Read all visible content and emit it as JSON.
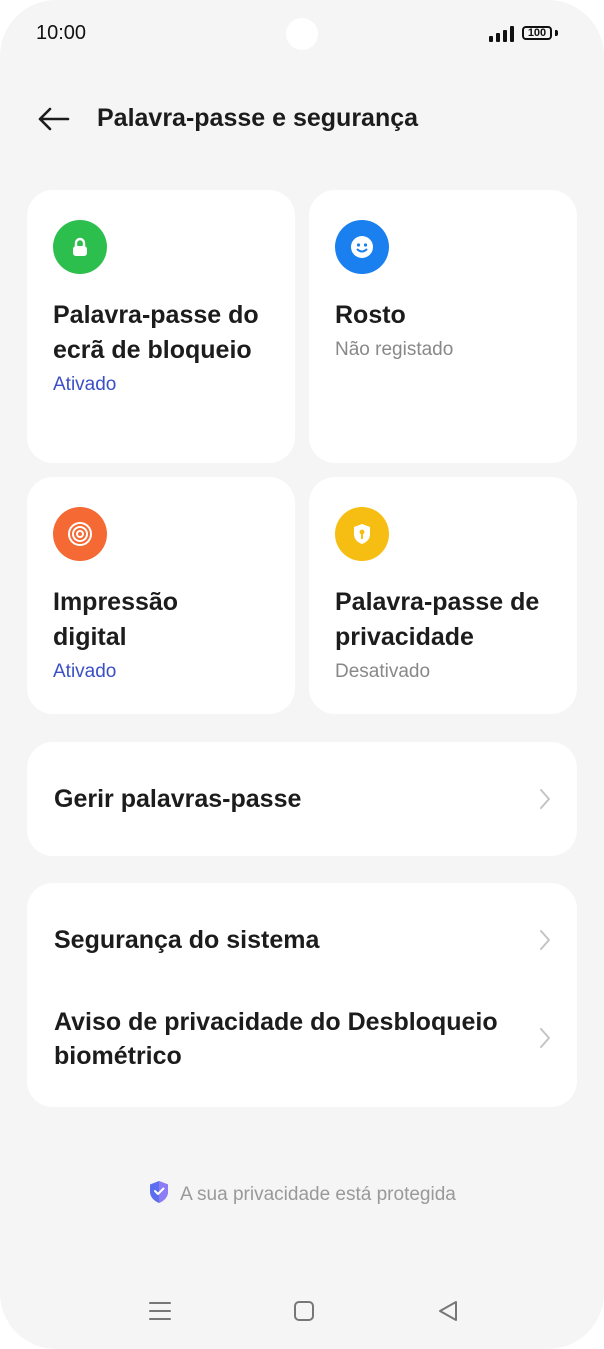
{
  "status_bar": {
    "time": "10:00",
    "battery": "100"
  },
  "header": {
    "title": "Palavra-passe e segurança"
  },
  "cards": [
    {
      "title": "Palavra-passe do ecrã de bloqueio",
      "status": "Ativado",
      "icon": "lock-icon",
      "color": "#2dbf4e"
    },
    {
      "title": "Rosto",
      "status": "Não registado",
      "icon": "face-icon",
      "color": "#1a80f0"
    },
    {
      "title": "Impressão digital",
      "status": "Ativado",
      "icon": "fingerprint-icon",
      "color": "#f56a34"
    },
    {
      "title": "Palavra-passe de privacidade",
      "status": "Desativado",
      "icon": "shield-key-icon",
      "color": "#f6be12"
    }
  ],
  "manage": {
    "label": "Gerir palavras-passe"
  },
  "security": {
    "system_label": "Segurança do sistema",
    "biometric_label": "Aviso de privacidade do Desbloqueio biométrico"
  },
  "footer": {
    "privacy_text": "A sua privacidade está protegida"
  }
}
